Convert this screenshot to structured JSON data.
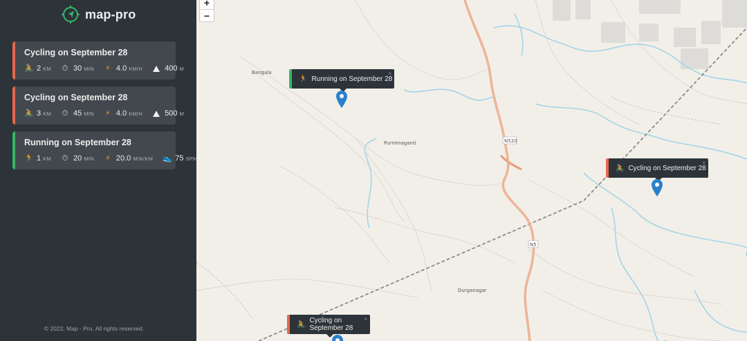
{
  "app": {
    "name": "map-pro"
  },
  "workouts": [
    {
      "type": "cycling",
      "title": "Cycling on September 28",
      "icon": "🚴",
      "distance": "2",
      "distance_unit": "km",
      "duration": "30",
      "duration_unit": "min",
      "speed": "4.0",
      "speed_unit": "km/h",
      "extra": "400",
      "extra_unit": "m"
    },
    {
      "type": "cycling",
      "title": "Cycling on September 28",
      "icon": "🚴",
      "distance": "3",
      "distance_unit": "km",
      "duration": "45",
      "duration_unit": "min",
      "speed": "4.0",
      "speed_unit": "km/h",
      "extra": "500",
      "extra_unit": "m"
    },
    {
      "type": "running",
      "title": "Running on September 28",
      "icon": "🏃",
      "distance": "1",
      "distance_unit": "km",
      "duration": "20",
      "duration_unit": "min",
      "speed": "20.0",
      "speed_unit": "min/km",
      "extra": "75",
      "extra_unit": "spm"
    }
  ],
  "icons": {
    "timer": "⏱",
    "bolt": "⚡",
    "elevation": "⛰",
    "cadence": "👟",
    "close": "×"
  },
  "copyright": "© 2022, Map - Pro. All rights reserved.",
  "map": {
    "zoom_in": "+",
    "zoom_out": "−",
    "places": [
      "Bangala",
      "Purnimaganti",
      "Durganagar",
      "N520",
      "N5"
    ],
    "popups": [
      {
        "type": "running",
        "icon": "🏃",
        "label": "Running on September 28"
      },
      {
        "type": "cycling",
        "icon": "🚴",
        "label": "Cycling on September 28"
      },
      {
        "type": "cycling",
        "icon": "🚴",
        "label": "Cycling on September 28"
      }
    ]
  },
  "colors": {
    "cycling": "#e5684d",
    "running": "#36b76a",
    "marker": "#2a81cb",
    "road_main": "#e8a07c",
    "water": "#a4d4e6"
  }
}
